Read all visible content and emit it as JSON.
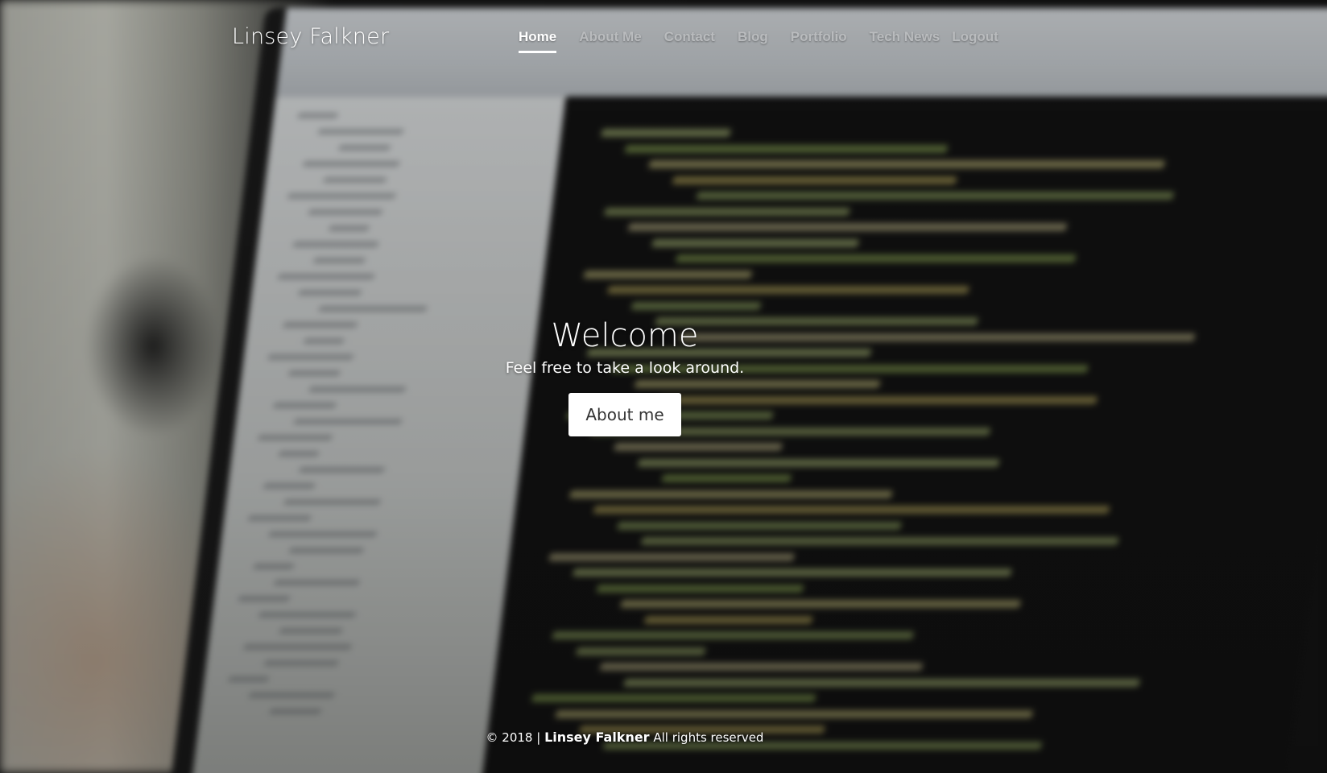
{
  "header": {
    "brand": "Linsey Falkner",
    "nav": [
      {
        "label": "Home",
        "active": true
      },
      {
        "label": "About Me",
        "active": false
      },
      {
        "label": "Contact",
        "active": false
      },
      {
        "label": "Blog",
        "active": false
      },
      {
        "label": "Portfolio",
        "active": false
      },
      {
        "label": "Tech News",
        "active": false
      },
      {
        "label": "Logout",
        "active": false
      }
    ]
  },
  "hero": {
    "title": "Welcome",
    "subtitle": "Feel free to take a look around.",
    "button_label": "About me"
  },
  "footer": {
    "copyright": "© 2018 |",
    "name": "Linsey Falkner",
    "rights": "All rights reserved"
  },
  "colors": {
    "nav_active": "#ffffff",
    "nav_inactive": "#bebfc1",
    "button_bg": "#ffffff",
    "button_text": "#333333"
  }
}
